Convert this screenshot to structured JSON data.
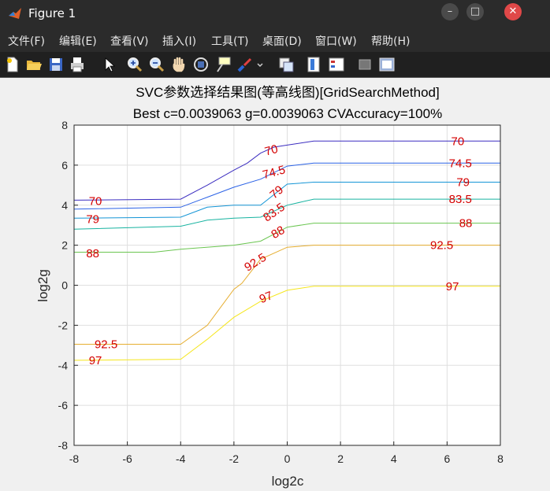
{
  "window": {
    "title": "Figure 1",
    "minimize": "–",
    "maximize": "□",
    "close": "✕",
    "app_icon": "matlab-logo-icon"
  },
  "menu": [
    "文件(F)",
    "编辑(E)",
    "查看(V)",
    "插入(I)",
    "工具(T)",
    "桌面(D)",
    "窗口(W)",
    "帮助(H)"
  ],
  "toolbar": [
    "new-figure-icon",
    "open-file-icon",
    "save-icon",
    "print-icon",
    "pointer-icon",
    "zoom-in-icon",
    "zoom-out-icon",
    "pan-hand-icon",
    "rotate-3d-icon",
    "data-cursor-icon",
    "brush-icon",
    "brush-dropdown-icon",
    "link-plot-icon",
    "colorbar-icon",
    "legend-icon",
    "hide-plot-tools-icon",
    "show-plot-tools-icon"
  ],
  "chart_data": {
    "type": "contour",
    "title": "SVC参数选择结果图(等高线图)[GridSearchMethod]",
    "subtitle": "Best c=0.0039063 g=0.0039063 CVAccuracy=100%",
    "xlabel": "log2c",
    "ylabel": "log2g",
    "xlim": [
      -8,
      8
    ],
    "ylim": [
      -8,
      8
    ],
    "xticks": [
      "-8",
      "-6",
      "-4",
      "-2",
      "0",
      "2",
      "4",
      "6",
      "8"
    ],
    "yticks": [
      "8",
      "6",
      "4",
      "2",
      "0",
      "-2",
      "-4",
      "-6",
      "-8"
    ],
    "grid": true,
    "series": [
      {
        "name": "70",
        "color": "#3b2dc0",
        "x": [
          -8,
          -4,
          -3,
          -2,
          -1.5,
          -1,
          -0.5,
          0,
          1,
          8
        ],
        "y": [
          4.25,
          4.3,
          5.0,
          5.75,
          6.1,
          6.6,
          6.9,
          7.0,
          7.2,
          7.2
        ]
      },
      {
        "name": "74.5",
        "color": "#2b62e6",
        "x": [
          -8,
          -4,
          -3,
          -2,
          -1,
          0,
          1,
          8
        ],
        "y": [
          3.8,
          3.9,
          4.4,
          4.9,
          5.3,
          5.95,
          6.1,
          6.1
        ]
      },
      {
        "name": "79",
        "color": "#1495d6",
        "x": [
          -8,
          -4,
          -3,
          -2,
          -1,
          0,
          1,
          8
        ],
        "y": [
          3.35,
          3.4,
          3.9,
          4.0,
          4.0,
          5.05,
          5.15,
          5.15
        ]
      },
      {
        "name": "83.5",
        "color": "#17b3a0",
        "x": [
          -8,
          -4,
          -3,
          -2,
          -1,
          0,
          1,
          8
        ],
        "y": [
          2.8,
          2.95,
          3.25,
          3.35,
          3.4,
          4.0,
          4.3,
          4.3
        ]
      },
      {
        "name": "88",
        "color": "#6ac550",
        "x": [
          -8,
          -5,
          -4,
          -2,
          -1,
          0,
          1,
          8
        ],
        "y": [
          1.65,
          1.65,
          1.8,
          2.0,
          2.2,
          2.9,
          3.1,
          3.1
        ]
      },
      {
        "name": "92.5",
        "color": "#e6ae30",
        "x": [
          -8,
          -4,
          -3,
          -2,
          -1.7,
          -1,
          0,
          1,
          8
        ],
        "y": [
          -2.95,
          -2.95,
          -2.0,
          -0.2,
          0.1,
          1.3,
          1.9,
          2.0,
          2.0
        ]
      },
      {
        "name": "97",
        "color": "#f5e61c",
        "x": [
          -8,
          -4,
          -3,
          -2,
          -1,
          0,
          1,
          8
        ],
        "y": [
          -3.75,
          -3.7,
          -2.7,
          -1.6,
          -0.8,
          -0.25,
          -0.05,
          -0.05
        ]
      }
    ],
    "contour_labels": [
      {
        "text": "70",
        "x": -7.2,
        "y": 4.2,
        "rot": 0
      },
      {
        "text": "70",
        "x": -0.6,
        "y": 6.75,
        "rot": -15
      },
      {
        "text": "70",
        "x": 6.4,
        "y": 7.2,
        "rot": 0
      },
      {
        "text": "74.5",
        "x": -0.5,
        "y": 5.65,
        "rot": -15
      },
      {
        "text": "74.5",
        "x": 6.5,
        "y": 6.1,
        "rot": 0
      },
      {
        "text": "79",
        "x": -7.3,
        "y": 3.3,
        "rot": 0
      },
      {
        "text": "79",
        "x": -0.4,
        "y": 4.65,
        "rot": -40
      },
      {
        "text": "79",
        "x": 6.6,
        "y": 5.15,
        "rot": 0
      },
      {
        "text": "83.5",
        "x": -0.5,
        "y": 3.65,
        "rot": -35
      },
      {
        "text": "83.5",
        "x": 6.5,
        "y": 4.3,
        "rot": 0
      },
      {
        "text": "88",
        "x": -7.3,
        "y": 1.6,
        "rot": 0
      },
      {
        "text": "88",
        "x": -0.35,
        "y": 2.65,
        "rot": -30
      },
      {
        "text": "88",
        "x": 6.7,
        "y": 3.1,
        "rot": 0
      },
      {
        "text": "92.5",
        "x": -6.8,
        "y": -2.95,
        "rot": 0
      },
      {
        "text": "92.5",
        "x": -1.2,
        "y": 1.15,
        "rot": -32
      },
      {
        "text": "92.5",
        "x": 5.8,
        "y": 2.0,
        "rot": 0
      },
      {
        "text": "97",
        "x": -7.2,
        "y": -3.75,
        "rot": 0
      },
      {
        "text": "97",
        "x": -0.8,
        "y": -0.6,
        "rot": -22
      },
      {
        "text": "97",
        "x": 6.2,
        "y": -0.05,
        "rot": 0
      }
    ]
  }
}
